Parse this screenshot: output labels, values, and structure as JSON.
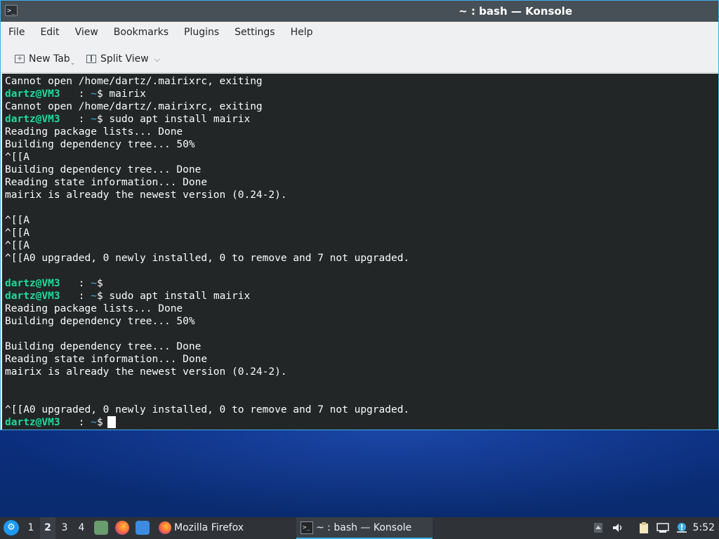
{
  "window": {
    "title": "~ : bash — Konsole",
    "app_icon_glyph": ">_"
  },
  "menubar": {
    "items": [
      "File",
      "Edit",
      "View",
      "Bookmarks",
      "Plugins",
      "Settings",
      "Help"
    ]
  },
  "toolbar": {
    "new_tab_label": "New Tab",
    "split_view_label": "Split View"
  },
  "terminal": {
    "lines": [
      {
        "text": "Cannot open /home/dartz/.mairixrc, exiting"
      },
      {
        "user": "dartz@VM3",
        "sep": "   : ",
        "path": "~",
        "cmd": "$ mairix"
      },
      {
        "text": "Cannot open /home/dartz/.mairixrc, exiting"
      },
      {
        "user": "dartz@VM3",
        "sep": "   : ",
        "path": "~",
        "cmd": "$ sudo apt install mairix"
      },
      {
        "text": "Reading package lists... Done"
      },
      {
        "text": "Building dependency tree... 50%"
      },
      {
        "text": "^[[A"
      },
      {
        "text": "Building dependency tree... Done"
      },
      {
        "text": "Reading state information... Done"
      },
      {
        "text": "mairix is already the newest version (0.24-2)."
      },
      {
        "text": ""
      },
      {
        "text": "^[[A"
      },
      {
        "text": "^[[A"
      },
      {
        "text": "^[[A"
      },
      {
        "text": "^[[A0 upgraded, 0 newly installed, 0 to remove and 7 not upgraded."
      },
      {
        "text": ""
      },
      {
        "user": "dartz@VM3",
        "sep": "   : ",
        "path": "~",
        "cmd": "$"
      },
      {
        "user": "dartz@VM3",
        "sep": "   : ",
        "path": "~",
        "cmd": "$ sudo apt install mairix"
      },
      {
        "text": "Reading package lists... Done"
      },
      {
        "text": "Building dependency tree... 50%"
      },
      {
        "text": ""
      },
      {
        "text": "Building dependency tree... Done"
      },
      {
        "text": "Reading state information... Done"
      },
      {
        "text": "mairix is already the newest version (0.24-2)."
      },
      {
        "text": ""
      },
      {
        "text": ""
      },
      {
        "text": "^[[A0 upgraded, 0 newly installed, 0 to remove and 7 not upgraded."
      },
      {
        "user": "dartz@VM3",
        "sep": "   : ",
        "path": "~",
        "cmd": "$",
        "cursor": true
      }
    ],
    "colors": {
      "background": "#232627",
      "text": "#fcfcfc",
      "user": "#1cdc9a",
      "path": "#3daee9"
    }
  },
  "taskbar": {
    "desktops": [
      "1",
      "2",
      "3",
      "4"
    ],
    "active_desktop": "2",
    "tasks": {
      "firefox": "Mozilla Firefox",
      "konsole": "~ : bash — Konsole"
    },
    "clock": "5:52",
    "icons": [
      "plasma-kicker-icon",
      "file-manager-icon",
      "firefox-icon",
      "folder-icon",
      "clipboard-icon",
      "volume-icon",
      "network-icon",
      "notifications-icon"
    ]
  }
}
